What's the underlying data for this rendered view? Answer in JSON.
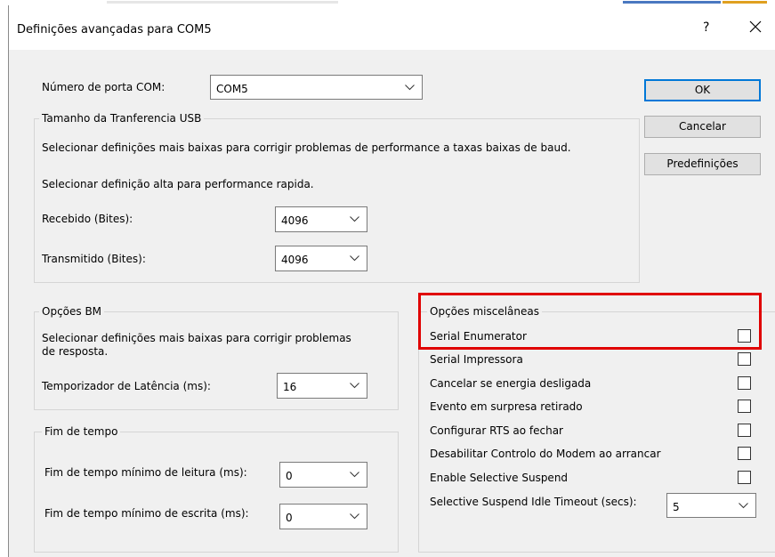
{
  "window": {
    "title": "Definições avançadas para COM5",
    "help_label": "?",
    "close_icon": "close-icon"
  },
  "com_port": {
    "label": "Número de porta COM:",
    "value": "COM5"
  },
  "buttons": {
    "ok": "OK",
    "cancel": "Cancelar",
    "defaults": "Predefinições"
  },
  "usb_transfer": {
    "legend": "Tamanho da Tranferencia USB",
    "line1": "Selecionar definições mais baixas para corrigir problemas de performance a taxas baixas de baud.",
    "line2": "Selecionar definição alta para performance rapida.",
    "received_label": "Recebido (Bites):",
    "received_value": "4096",
    "transmitted_label": "Transmitido (Bites):",
    "transmitted_value": "4096"
  },
  "bm_options": {
    "legend": "Opções BM",
    "line1": "Selecionar definições mais baixas para corrigir problemas",
    "line2": "de resposta.",
    "latency_label": "Temporizador de Latência (ms):",
    "latency_value": "16"
  },
  "timeouts": {
    "legend": "Fim de tempo",
    "read_label": "Fim de tempo mínimo de leitura (ms):",
    "read_value": "0",
    "write_label": "Fim de tempo mínimo de escrita (ms):",
    "write_value": "0"
  },
  "misc_options": {
    "legend": "Opções miscelâneas",
    "items": [
      {
        "label": "Serial Enumerator",
        "checked": false
      },
      {
        "label": "Serial Impressora",
        "checked": false
      },
      {
        "label": "Cancelar se energia desligada",
        "checked": false
      },
      {
        "label": "Evento em surpresa retirado",
        "checked": false
      },
      {
        "label": "Configurar RTS ao fechar",
        "checked": false
      },
      {
        "label": "Desabilitar Controlo do Modem ao arrancar",
        "checked": false
      },
      {
        "label": "Enable Selective Suspend",
        "checked": false
      }
    ],
    "idle_timeout_label": "Selective Suspend Idle Timeout (secs):",
    "idle_timeout_value": "5"
  },
  "colors": {
    "dialog_bg": "#f0f0f0",
    "default_button_border": "#0078d7",
    "highlight": "#e00000"
  }
}
